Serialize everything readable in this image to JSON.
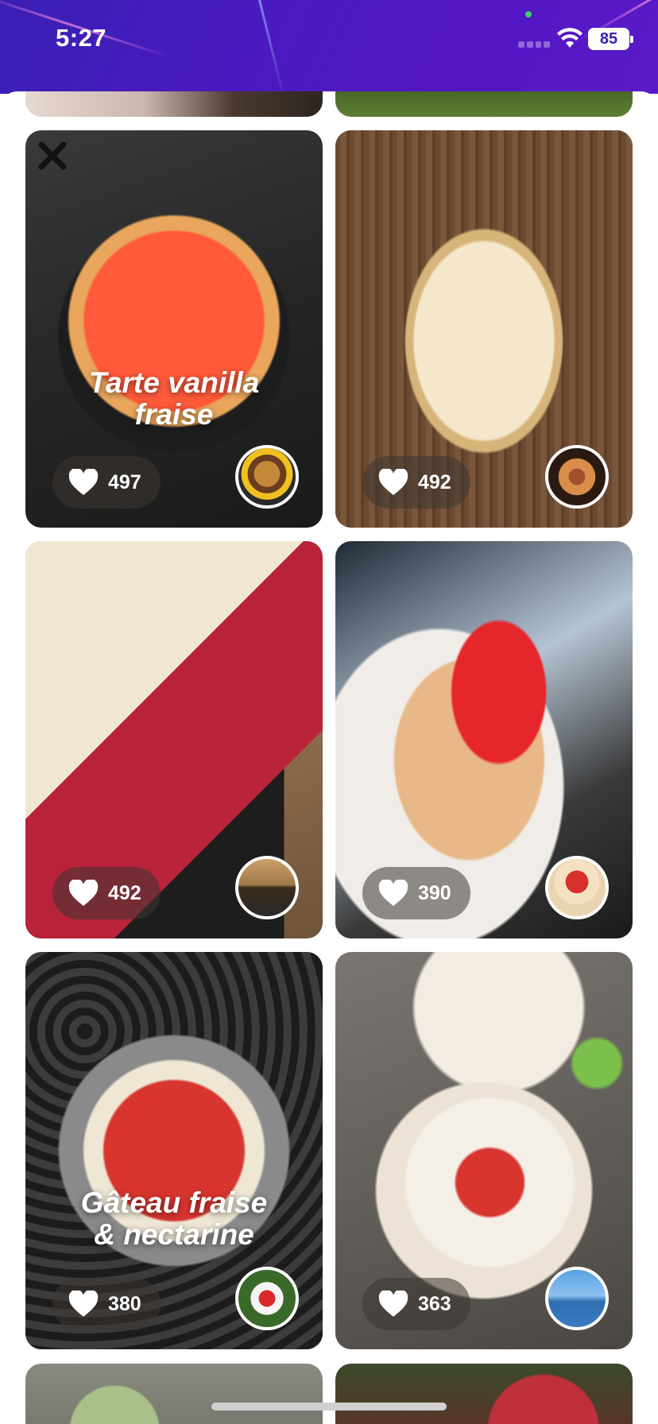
{
  "status_bar": {
    "time": "5:27",
    "battery": "85",
    "icons": [
      "cellular-signal-icon",
      "wifi-icon",
      "battery-icon"
    ]
  },
  "feed": {
    "cards": [
      {
        "title": "Tarte vanilla fraise",
        "title_lines": [
          "Tarte vanilla",
          "fraise"
        ],
        "likes": "497",
        "avatar": "user-avatar"
      },
      {
        "title": "",
        "likes": "492",
        "avatar": "user-avatar"
      },
      {
        "title": "",
        "likes": "492",
        "avatar": "user-avatar"
      },
      {
        "title": "",
        "likes": "390",
        "avatar": "user-avatar"
      },
      {
        "title": "Gâteau fraise & nectarine",
        "title_lines": [
          "Gâteau fraise",
          "& nectarine"
        ],
        "likes": "380",
        "avatar": "user-avatar"
      },
      {
        "title": "",
        "likes": "363",
        "avatar": "user-avatar"
      }
    ]
  },
  "colors": {
    "status_bar": "#4a1ac0",
    "like_pill": "rgba(60,55,50,0.55)",
    "text_on_photo": "#ffffff"
  }
}
